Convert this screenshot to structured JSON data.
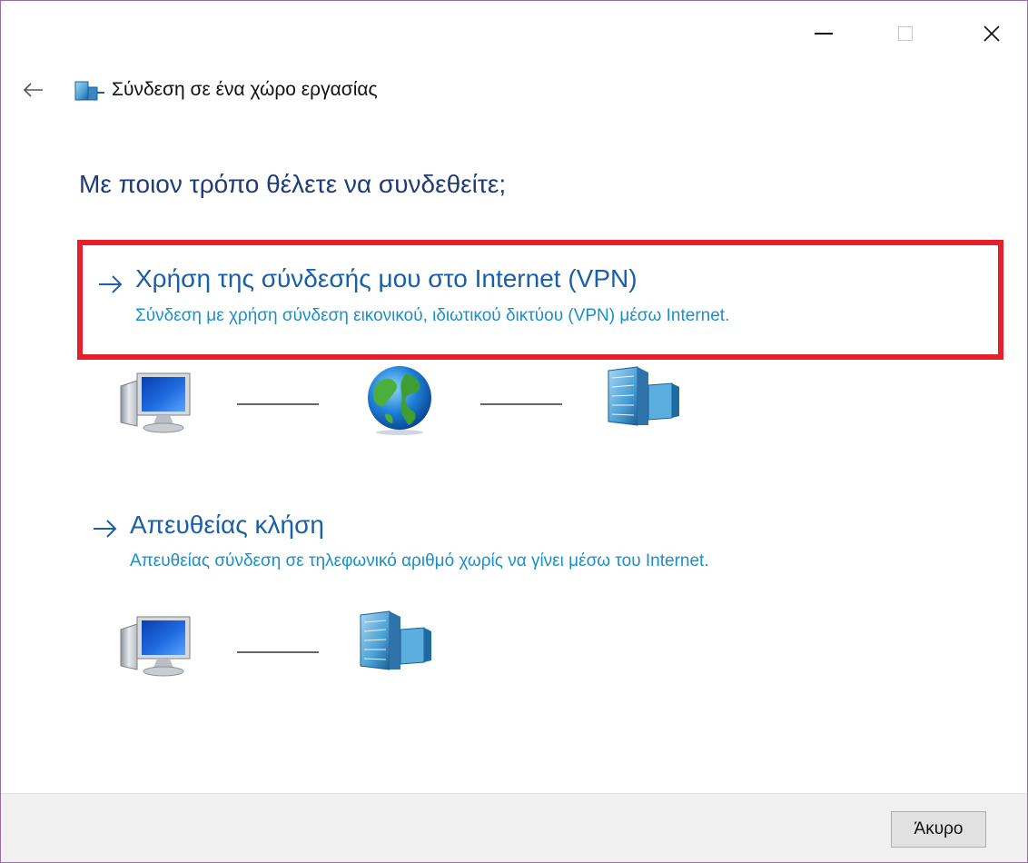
{
  "window": {
    "controls": {
      "minimize_icon": "minimize-icon",
      "maximize_icon": "maximize-icon",
      "close_icon": "close-icon"
    }
  },
  "header": {
    "back_icon": "back-arrow-icon",
    "title": "Σύνδεση σε ένα χώρο εργασίας"
  },
  "question": "Με ποιον τρόπο θέλετε να συνδεθείτε;",
  "options": [
    {
      "title": "Χρήση της σύνδεσής μου στο Internet (VPN)",
      "description": "Σύνδεση με χρήση σύνδεση εικονικού, ιδιωτικού δικτύου (VPN) μέσω Internet.",
      "highlighted": true,
      "diagram": [
        "computer-icon",
        "globe-icon",
        "building-icon"
      ]
    },
    {
      "title": "Απευθείας κλήση",
      "description": "Απευθείας σύνδεση σε τηλεφωνικό αριθμό χωρίς να γίνει μέσω του Internet.",
      "highlighted": false,
      "diagram": [
        "computer-icon",
        "building-icon"
      ]
    }
  ],
  "footer": {
    "cancel_label": "Άκυρο"
  },
  "colors": {
    "heading": "#1e3c78",
    "link_title": "#1a5fa8",
    "link_description": "#1a8fc8",
    "highlight_border": "#e5202a",
    "window_border": "#9a6aa6"
  }
}
